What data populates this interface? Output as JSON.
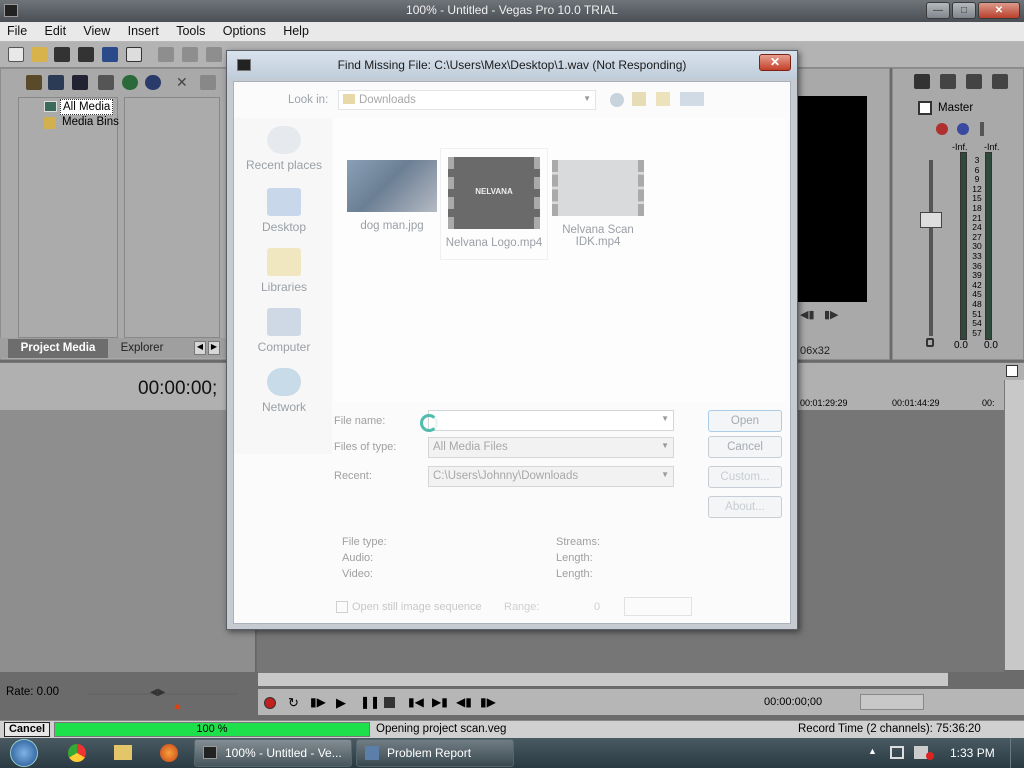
{
  "app": {
    "title": "100% - Untitled - Vegas Pro 10.0 TRIAL",
    "menu": [
      "File",
      "Edit",
      "View",
      "Insert",
      "Tools",
      "Options",
      "Help"
    ]
  },
  "project_media": {
    "tree": [
      "All Media",
      "Media Bins"
    ],
    "tabs": [
      "Project Media",
      "Explorer"
    ]
  },
  "timeline": {
    "timecode": "00:00:00;",
    "ruler": [
      "00:01:29:29",
      "00:01:44:29",
      "00:"
    ],
    "rate_label": "Rate: 0.00",
    "transport_time": "00:00:00;00"
  },
  "preview": {
    "resolution_suffix": "06x32"
  },
  "mixer": {
    "master_label": "Master",
    "peak_left": "-Inf.",
    "peak_right": "-Inf.",
    "scale": [
      "3",
      "6",
      "9",
      "12",
      "15",
      "18",
      "21",
      "24",
      "27",
      "30",
      "33",
      "36",
      "39",
      "42",
      "45",
      "48",
      "51",
      "54",
      "57"
    ],
    "level_left": "0.0",
    "level_right": "0.0"
  },
  "dialog": {
    "title": "Find Missing File: C:\\Users\\Mex\\Desktop\\1.wav (Not Responding)",
    "look_in_label": "Look in:",
    "look_in_value": "Downloads",
    "places": [
      "Recent places",
      "Desktop",
      "Libraries",
      "Computer",
      "Network"
    ],
    "files": [
      "dog man.jpg",
      "Nelvana Logo.mp4",
      "Nelvana Scan IDK.mp4"
    ],
    "thumb_caption": "NELVANA",
    "file_name_label": "File name:",
    "file_name_value": "",
    "files_of_type_label": "Files of type:",
    "files_of_type_value": "All Media Files",
    "recent_label": "Recent:",
    "recent_value": "C:\\Users\\Johnny\\Downloads",
    "buttons": {
      "open": "Open",
      "cancel": "Cancel",
      "custom": "Custom...",
      "about": "About..."
    },
    "info": {
      "file_type": "File type:",
      "audio": "Audio:",
      "video": "Video:",
      "streams": "Streams:",
      "length1": "Length:",
      "length2": "Length:"
    },
    "still_sequence": "Open still image sequence",
    "range_label": "Range:",
    "range_value": "0"
  },
  "status": {
    "cancel": "Cancel",
    "progress_text": "100 %",
    "progress": 1.0,
    "message": "Opening project scan.veg",
    "record_time": "Record Time (2 channels): 75:36:20"
  },
  "taskbar": {
    "tasks": [
      "100% - Untitled - Ve...",
      "Problem Report"
    ],
    "clock": "1:33 PM"
  },
  "colors": {
    "progress": "#1ee04a",
    "close": "#c4402a"
  }
}
